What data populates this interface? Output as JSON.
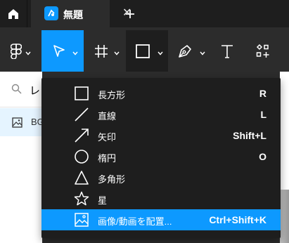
{
  "tab": {
    "title": "無題",
    "close_glyph": "✕"
  },
  "left_panel": {
    "search_letter": "レ",
    "layer_label": "BG"
  },
  "menu": {
    "items": [
      {
        "label": "長方形",
        "shortcut": "R",
        "icon": "rectangle-icon"
      },
      {
        "label": "直線",
        "shortcut": "L",
        "icon": "line-icon"
      },
      {
        "label": "矢印",
        "shortcut": "Shift+L",
        "icon": "arrow-icon"
      },
      {
        "label": "楕円",
        "shortcut": "O",
        "icon": "ellipse-icon"
      },
      {
        "label": "多角形",
        "shortcut": "",
        "icon": "polygon-icon"
      },
      {
        "label": "星",
        "shortcut": "",
        "icon": "star-icon"
      },
      {
        "label": "画像/動画を配置...",
        "shortcut": "Ctrl+Shift+K",
        "icon": "image-icon",
        "highlighted": true
      }
    ]
  },
  "colors": {
    "accent": "#0d99ff",
    "toolbar": "#2c2c2c",
    "tabbar": "#1e1e1e",
    "menu": "#1e1e1e"
  }
}
